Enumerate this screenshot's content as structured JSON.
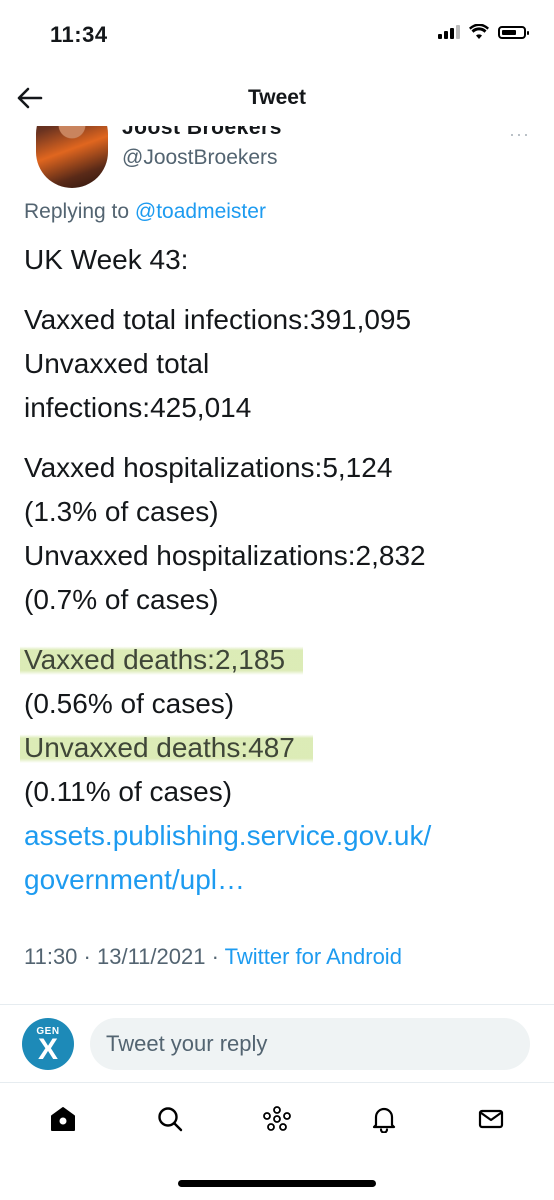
{
  "status_bar": {
    "time": "11:34"
  },
  "header": {
    "title": "Tweet"
  },
  "author": {
    "name": "Joost Broekers",
    "handle": "@JoostBroekers",
    "more": "···"
  },
  "reply": {
    "prefix": "Replying to ",
    "target": "@toadmeister"
  },
  "tweet": {
    "heading": "UK Week 43:",
    "infections": [
      "Vaxxed total infections:391,095",
      "Unvaxxed total",
      "infections:425,014"
    ],
    "hospitalizations": [
      "Vaxxed hospitalizations:5,124",
      "(1.3% of cases)",
      "Unvaxxed hospitalizations:2,832",
      "(0.7% of cases)"
    ],
    "deaths": {
      "vaxxed": "Vaxxed deaths:2,185",
      "vaxxed_pct": "(0.56% of cases)",
      "unvaxxed": "Unvaxxed deaths:487",
      "unvaxxed_pct": "(0.11% of cases)"
    },
    "link": [
      "assets.publishing.service.gov.uk/",
      "government/upl…"
    ]
  },
  "meta": {
    "time": "11:30",
    "sep1": " · ",
    "date": "13/11/2021",
    "sep2": " · ",
    "source": "Twitter for Android"
  },
  "reply_bar": {
    "avatar_top": "GEN",
    "avatar_letter": "X",
    "placeholder": "Tweet your reply"
  },
  "colors": {
    "link": "#1d9bf0",
    "secondary": "#536471",
    "highlight": "#d6e8aa"
  },
  "nav_icons": [
    "home-icon",
    "search-icon",
    "spaces-icon",
    "notifications-icon",
    "messages-icon"
  ]
}
